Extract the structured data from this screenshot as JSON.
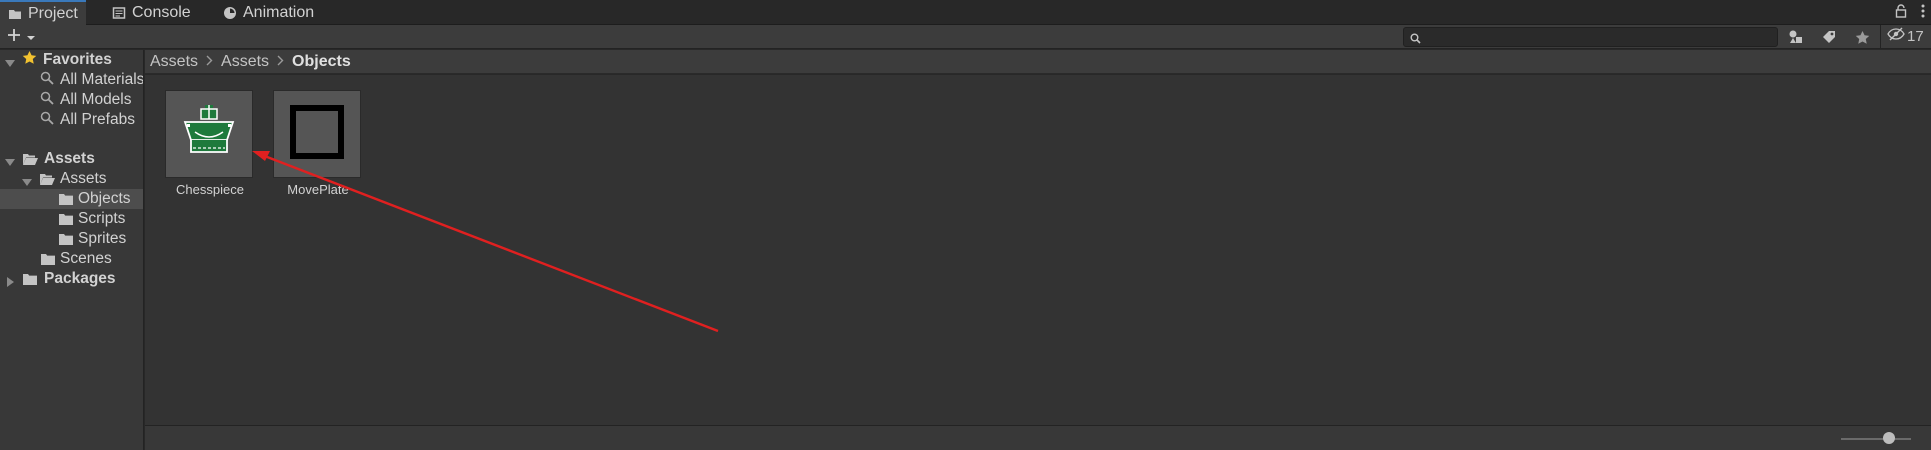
{
  "tabs": [
    {
      "label": "Project",
      "icon": "folder-icon",
      "active": true
    },
    {
      "label": "Console",
      "icon": "console-icon",
      "active": false
    },
    {
      "label": "Animation",
      "icon": "animation-clock-icon",
      "active": false
    }
  ],
  "toolbar": {
    "search_placeholder": "",
    "hidden_count": "17"
  },
  "sidebar": {
    "favorites": {
      "label": "Favorites",
      "items": [
        "All Materials",
        "All Models",
        "All Prefabs"
      ]
    },
    "assets_root": "Assets",
    "assets_child": "Assets",
    "assets_children": [
      "Objects",
      "Scripts",
      "Sprites"
    ],
    "scenes": "Scenes",
    "packages": "Packages",
    "selected": "Objects"
  },
  "breadcrumb": {
    "items": [
      "Assets",
      "Assets"
    ],
    "current": "Objects"
  },
  "assets": [
    {
      "name": "Chesspiece",
      "thumb": "green-chess-king-sprite"
    },
    {
      "name": "MovePlate",
      "thumb": "black-square-frame-sprite"
    }
  ],
  "colors": {
    "accent": "#3a79bb",
    "sprite_green": "#1e7a3c",
    "annotation_red": "#e02020",
    "favorites_star": "#f2c230"
  }
}
